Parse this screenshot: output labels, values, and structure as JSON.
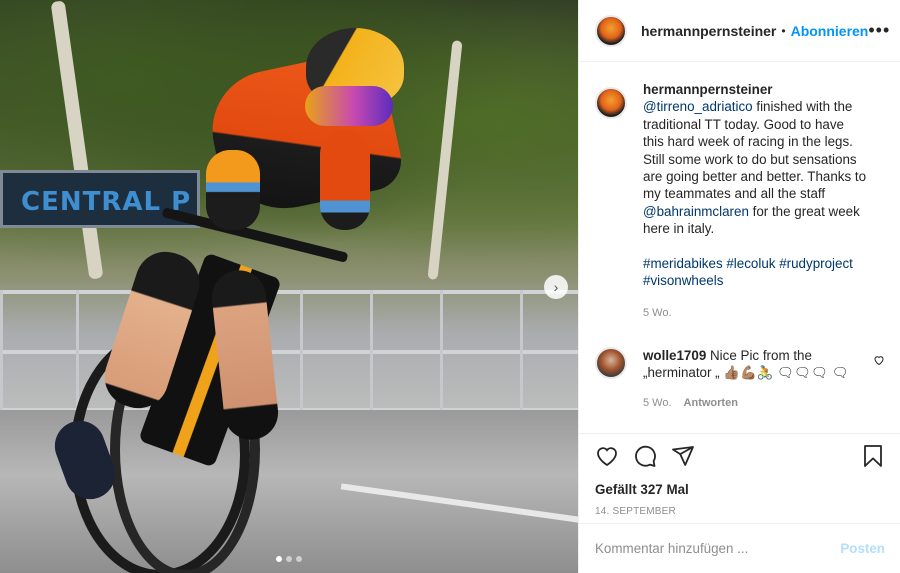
{
  "header": {
    "username": "hermannpernsteiner",
    "separator": "•",
    "follow_label": "Abonnieren",
    "more_label": "•••"
  },
  "caption": {
    "username": "hermannpernsteiner",
    "lines": [
      {
        "mention": "@tirreno_adriatico",
        "text": " finished with the"
      },
      {
        "text": "traditional TT today. Good to have"
      },
      {
        "text": "this hard week of racing in the legs."
      },
      {
        "text": "Still some work to do but sensations"
      },
      {
        "text": "are going better and better. Thanks to"
      },
      {
        "text": "my teammates and all the staff"
      },
      {
        "mention": "@bahrainmclaren",
        "text": " for the great week"
      },
      {
        "text": "here in italy."
      }
    ],
    "hashtags_line1": "#meridabikes #lecoluk #rudyproject",
    "hashtags_line2": "#visonwheels",
    "age": "5 Wo."
  },
  "comment": {
    "username": "wolle1709",
    "text": " Nice Pic from the „herminator „ 👍🏽💪🏽🚴 🗨🗨🗨 🗨",
    "age": "5 Wo.",
    "reply_label": "Antworten"
  },
  "actions": {
    "likes": "Gefällt 327 Mal",
    "date": "14. SEPTEMBER"
  },
  "add_comment": {
    "placeholder": "Kommentar hinzufügen ...",
    "post_label": "Posten"
  },
  "photo": {
    "sign_text": "CENTRAL P",
    "next_label": "›"
  },
  "colors": {
    "accent": "#0095f6",
    "link": "#00376b",
    "post_disabled": "#b2dffc"
  },
  "icons": [
    "heart-icon",
    "comment-icon",
    "share-icon",
    "bookmark-icon",
    "more-icon",
    "chevron-right-icon"
  ]
}
